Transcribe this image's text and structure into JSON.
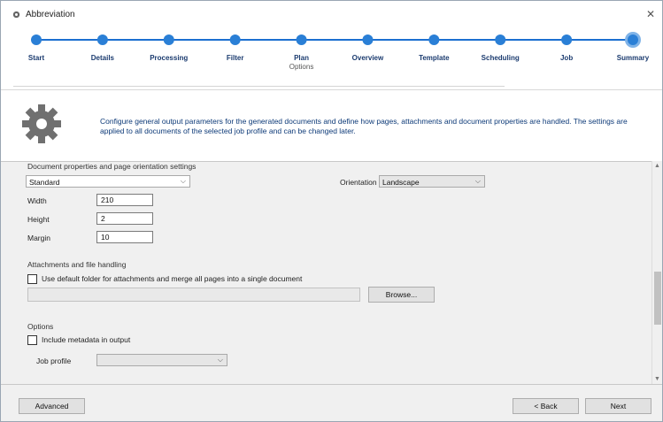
{
  "window": {
    "title": "Abbreviation",
    "close_glyph": "✕"
  },
  "steps": [
    {
      "label": "Start"
    },
    {
      "label": "Details"
    },
    {
      "label": "Processing"
    },
    {
      "label": "Filter"
    },
    {
      "label": "Plan",
      "sub": "Options"
    },
    {
      "label": "Overview"
    },
    {
      "label": "Template"
    },
    {
      "label": "Scheduling"
    },
    {
      "label": "Job"
    },
    {
      "label": "Summary"
    }
  ],
  "colors": {
    "step_line": "#1c6fd0",
    "step_dot": "#2a7fd6",
    "active_ring": "#7fb3e8",
    "description": "#0d3a78"
  },
  "info": {
    "icon": "gear-icon",
    "description": "Configure general output parameters for the generated documents and define how pages, attachments and document properties are handled. The settings are applied to all documents of the selected job profile and can be changed later."
  },
  "output": {
    "heading": "Document properties and page orientation settings",
    "format_value": "Standard",
    "orientation_label": "Orientation",
    "orientation_value": "Landscape",
    "width_label": "Width",
    "width_value": "210",
    "height_label": "Height",
    "height_value": "2",
    "margin_label": "Margin",
    "margin_value": "10"
  },
  "attachments": {
    "heading": "Attachments and file handling",
    "checkbox_label": "Use default folder for attachments and merge all pages into a single document",
    "browse_label": "Browse..."
  },
  "extras": {
    "heading": "Options",
    "checkbox_label": "Include metadata in output",
    "dropdown_label": "Job profile",
    "dropdown_value": ""
  },
  "footer": {
    "advanced_label": "Advanced",
    "back_label": "< Back",
    "next_label": "Next"
  }
}
